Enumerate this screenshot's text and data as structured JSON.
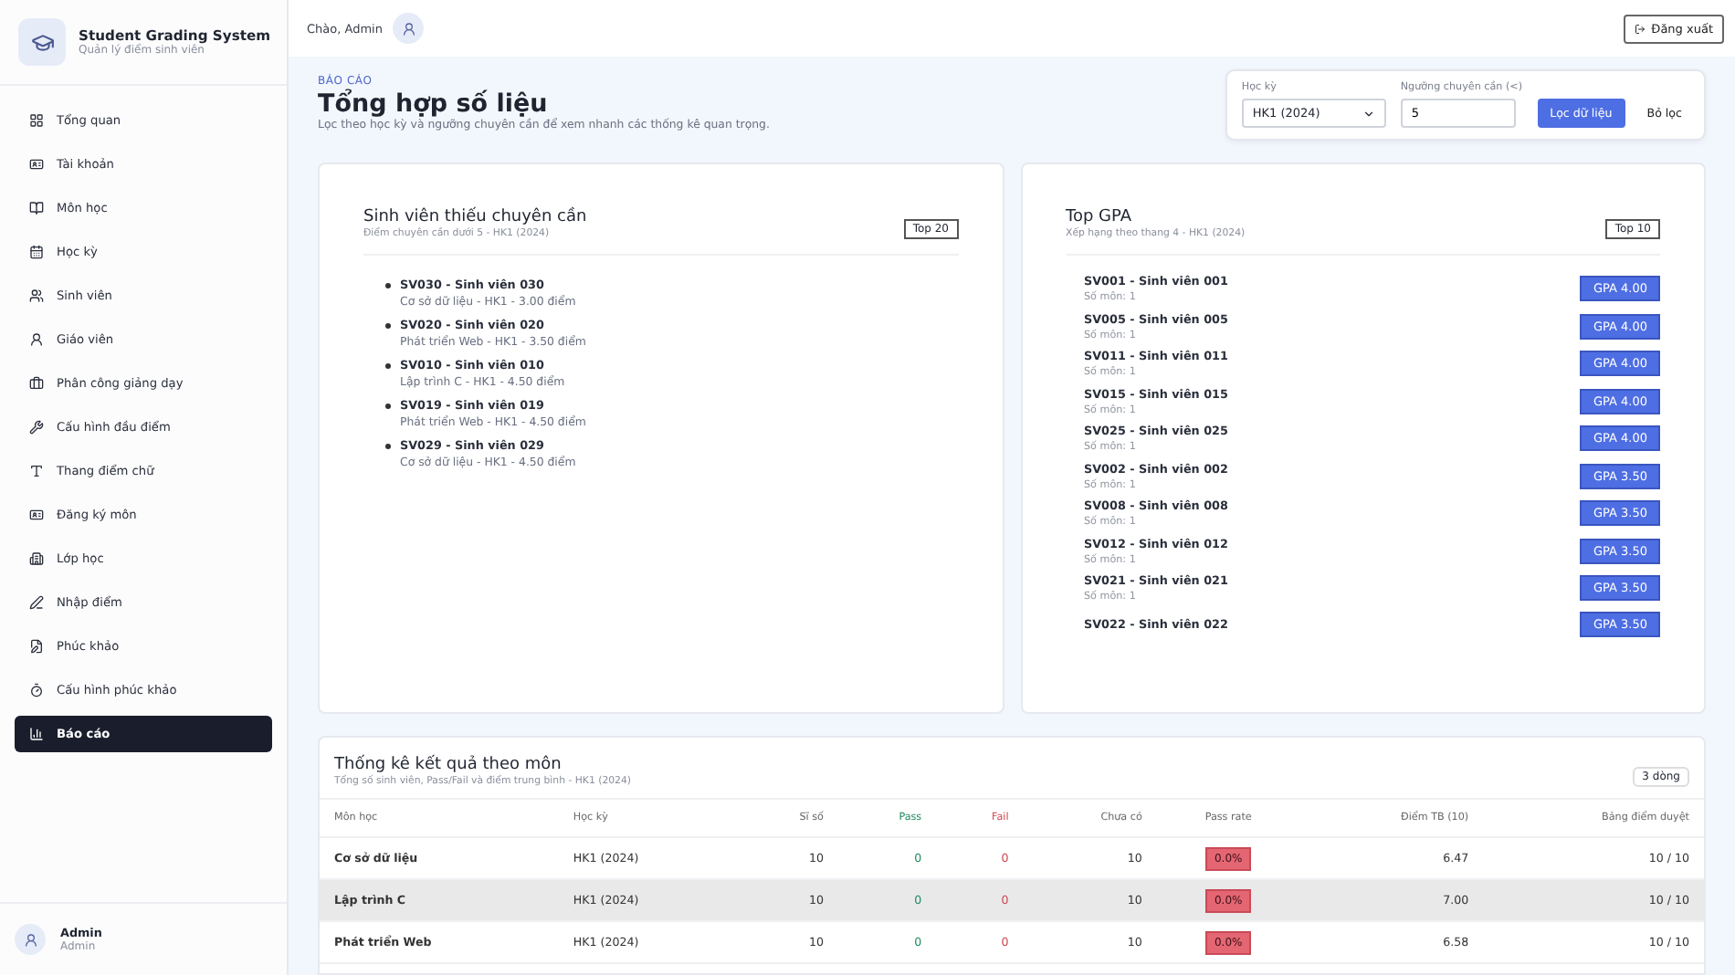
{
  "brand": {
    "title": "Student Grading System",
    "subtitle": "Quản lý điểm sinh viên"
  },
  "sidebar": {
    "items": [
      {
        "label": "Tổng quan",
        "selected": false
      },
      {
        "label": "Tài khoản",
        "selected": false
      },
      {
        "label": "Môn học",
        "selected": false
      },
      {
        "label": "Học kỳ",
        "selected": false
      },
      {
        "label": "Sinh viên",
        "selected": false
      },
      {
        "label": "Giáo viên",
        "selected": false
      },
      {
        "label": "Phân công giảng dạy",
        "selected": false
      },
      {
        "label": "Cấu hình đầu điểm",
        "selected": false
      },
      {
        "label": "Thang điểm chữ",
        "selected": false
      },
      {
        "label": "Đăng ký môn",
        "selected": false
      },
      {
        "label": "Lớp học",
        "selected": false
      },
      {
        "label": "Nhập điểm",
        "selected": false
      },
      {
        "label": "Phúc khảo",
        "selected": false
      },
      {
        "label": "Cấu hình phúc khảo",
        "selected": false
      },
      {
        "label": "Báo cáo",
        "selected": true
      }
    ]
  },
  "user": {
    "name": "Admin",
    "role": "Admin"
  },
  "header": {
    "greeting": "Chào, Admin",
    "logout": "Đăng xuất"
  },
  "hero": {
    "eyebrow": "BÁO CÁO",
    "title": "Tổng hợp số liệu",
    "subtitle": "Lọc theo học kỳ và ngưỡng chuyên cần để xem nhanh các thống kê quan trọng."
  },
  "filters": {
    "semester_label": "Học kỳ",
    "semester_value": "HK1 (2024)",
    "threshold_label": "Ngưỡng chuyên cần (<)",
    "threshold_value": "5",
    "apply": "Lọc dữ liệu",
    "clear": "Bỏ lọc"
  },
  "attendance": {
    "title": "Sinh viên thiếu chuyên cần",
    "subtitle": "Điểm chuyên cần dưới 5 - HK1 (2024)",
    "badge": "Top 20",
    "items": [
      {
        "name": "SV030 - Sinh viên 030",
        "detail": "Cơ sở dữ liệu - HK1 - 3.00 điểm"
      },
      {
        "name": "SV020 - Sinh viên 020",
        "detail": "Phát triển Web - HK1 - 3.50 điểm"
      },
      {
        "name": "SV010 - Sinh viên 010",
        "detail": "Lập trình C - HK1 - 4.50 điểm"
      },
      {
        "name": "SV019 - Sinh viên 019",
        "detail": "Phát triển Web - HK1 - 4.50 điểm"
      },
      {
        "name": "SV029 - Sinh viên 029",
        "detail": "Cơ sở dữ liệu - HK1 - 4.50 điểm"
      }
    ]
  },
  "top_gpa": {
    "title": "Top GPA",
    "subtitle": "Xếp hạng theo thang 4 - HK1 (2024)",
    "badge": "Top 10",
    "items": [
      {
        "name": "SV001 - Sinh viên 001",
        "detail": "Số môn: 1",
        "gpa": "GPA 4.00"
      },
      {
        "name": "SV005 - Sinh viên 005",
        "detail": "Số môn: 1",
        "gpa": "GPA 4.00"
      },
      {
        "name": "SV011 - Sinh viên 011",
        "detail": "Số môn: 1",
        "gpa": "GPA 4.00"
      },
      {
        "name": "SV015 - Sinh viên 015",
        "detail": "Số môn: 1",
        "gpa": "GPA 4.00"
      },
      {
        "name": "SV025 - Sinh viên 025",
        "detail": "Số môn: 1",
        "gpa": "GPA 4.00"
      },
      {
        "name": "SV002 - Sinh viên 002",
        "detail": "Số môn: 1",
        "gpa": "GPA 3.50"
      },
      {
        "name": "SV008 - Sinh viên 008",
        "detail": "Số môn: 1",
        "gpa": "GPA 3.50"
      },
      {
        "name": "SV012 - Sinh viên 012",
        "detail": "Số môn: 1",
        "gpa": "GPA 3.50"
      },
      {
        "name": "SV021 - Sinh viên 021",
        "detail": "Số môn: 1",
        "gpa": "GPA 3.50"
      },
      {
        "name": "SV022 - Sinh viên 022",
        "gpa": "GPA 3.50"
      }
    ]
  },
  "subject_stats": {
    "title": "Thống kê kết quả theo môn",
    "subtitle": "Tổng số sinh viên, Pass/Fail và điểm trung bình - HK1 (2024)",
    "badge": "3 dòng",
    "columns": [
      "Môn học",
      "Học kỳ",
      "Sĩ số",
      "Pass",
      "Fail",
      "Chưa có",
      "Pass rate",
      "Điểm TB (10)",
      "Bảng điểm duyệt"
    ],
    "rows": [
      {
        "selected": false,
        "cells": [
          "Cơ sở dữ liệu",
          "HK1 (2024)",
          "10",
          "0",
          "0",
          "10",
          "0.0%",
          "6.47",
          "10 / 10"
        ]
      },
      {
        "selected": true,
        "cells": [
          "Lập trình C",
          "HK1 (2024)",
          "10",
          "0",
          "0",
          "10",
          "0.0%",
          "7.00",
          "10 / 10"
        ]
      },
      {
        "selected": false,
        "cells": [
          "Phát triển Web",
          "HK1 (2024)",
          "10",
          "0",
          "0",
          "10",
          "0.0%",
          "6.58",
          "10 / 10"
        ]
      }
    ]
  }
}
